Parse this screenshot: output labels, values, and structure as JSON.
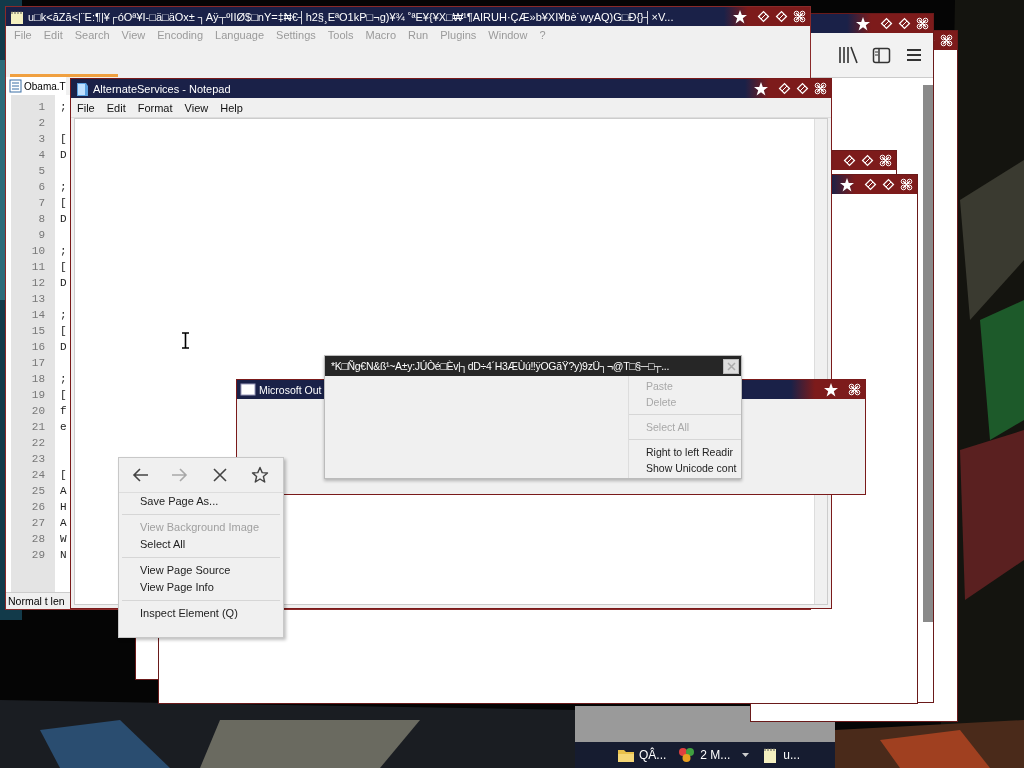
{
  "editor_window": {
    "title": "u□k<ăZă<|¨E:¶|¥┌óOª¥I-□ä□äOx± ┐Aÿ┬ºIIØ$□nY=‡₦€┤h2§¸EªO1kP□¬g)¥¾ ˚ªE¥{¥X□₩¹¶AIRUH·ÇÆ»b¥XI¥bè˙wyAQ)G□Đ{}┤×V...",
    "menu": [
      "File",
      "Edit",
      "Search",
      "View",
      "Encoding",
      "Language",
      "Settings",
      "Tools",
      "Macro",
      "Run",
      "Plugins",
      "Window",
      "?"
    ],
    "tab": "Obama.T",
    "lines": [
      {
        "number": "1",
        "text": ";"
      },
      {
        "number": "2"
      },
      {
        "number": "3",
        "text": "["
      },
      {
        "number": "4",
        "text": "D"
      },
      {
        "number": "5"
      },
      {
        "number": "6",
        "text": ";"
      },
      {
        "number": "7",
        "text": "["
      },
      {
        "number": "8",
        "text": "D"
      },
      {
        "number": "9"
      },
      {
        "number": "10",
        "text": ";"
      },
      {
        "number": "11",
        "text": "["
      },
      {
        "number": "12",
        "text": "D"
      },
      {
        "number": "13"
      },
      {
        "number": "14",
        "text": ";"
      },
      {
        "number": "15",
        "text": "["
      },
      {
        "number": "16",
        "text": "D"
      },
      {
        "number": "17"
      },
      {
        "number": "18",
        "text": ";"
      },
      {
        "number": "19",
        "text": "["
      },
      {
        "number": "20",
        "text": "f"
      },
      {
        "number": "21",
        "text": "e"
      },
      {
        "number": "22"
      },
      {
        "number": "23"
      },
      {
        "number": "24",
        "text": "["
      },
      {
        "number": "25",
        "text": "A"
      },
      {
        "number": "26",
        "text": "H"
      },
      {
        "number": "27",
        "text": "A"
      },
      {
        "number": "28",
        "text": "W"
      },
      {
        "number": "29",
        "text": "N"
      }
    ],
    "status": "Normal t len"
  },
  "notepad_window": {
    "title": "AlternateServices - Notepad",
    "menu": [
      "File",
      "Edit",
      "Format",
      "View",
      "Help"
    ]
  },
  "outlook_window": {
    "title": "Microsoft Out"
  },
  "glitch_popup": {
    "title": "*K□Ñg€N&ß¹~A±y:JÚÒé□Èv|┐dD÷4´H3ÆÙú‼ÿOGãŸ?y)9zÜ┐¬@T□§─□┬...",
    "menu_items": [
      {
        "kind": "item",
        "label": "Paste",
        "disabled": true
      },
      {
        "kind": "item",
        "label": "Delete",
        "disabled": true
      },
      {
        "kind": "separator"
      },
      {
        "kind": "item",
        "label": "Select All",
        "disabled": true
      },
      {
        "kind": "separator"
      },
      {
        "kind": "item",
        "label": "Right to left Readir",
        "disabled": false
      },
      {
        "kind": "item",
        "label": "Show Unicode cont",
        "disabled": false
      }
    ]
  },
  "context_menu": {
    "nav_buttons": [
      {
        "kind": "back",
        "disabled": false
      },
      {
        "kind": "forward",
        "disabled": true
      },
      {
        "kind": "stop",
        "disabled": false
      },
      {
        "kind": "bookmark",
        "disabled": false
      }
    ],
    "items": [
      {
        "kind": "item",
        "label": "Save Page As...",
        "disabled": false
      },
      {
        "kind": "separator"
      },
      {
        "kind": "item",
        "label": "View Background Image",
        "disabled": true
      },
      {
        "kind": "item",
        "label": "Select All",
        "disabled": false
      },
      {
        "kind": "separator"
      },
      {
        "kind": "item",
        "label": "View Page Source",
        "disabled": false
      },
      {
        "kind": "item",
        "label": "View Page Info",
        "disabled": false
      },
      {
        "kind": "separator"
      },
      {
        "kind": "item",
        "label": "Inspect Element (Q)",
        "disabled": false
      }
    ]
  },
  "taskbar": {
    "items": [
      {
        "kind": "folder",
        "label": "QÂ...",
        "menu": false
      },
      {
        "kind": "group",
        "label": "2 M...",
        "menu": true
      },
      {
        "kind": "notepad",
        "label": "u...",
        "menu": false
      }
    ]
  }
}
